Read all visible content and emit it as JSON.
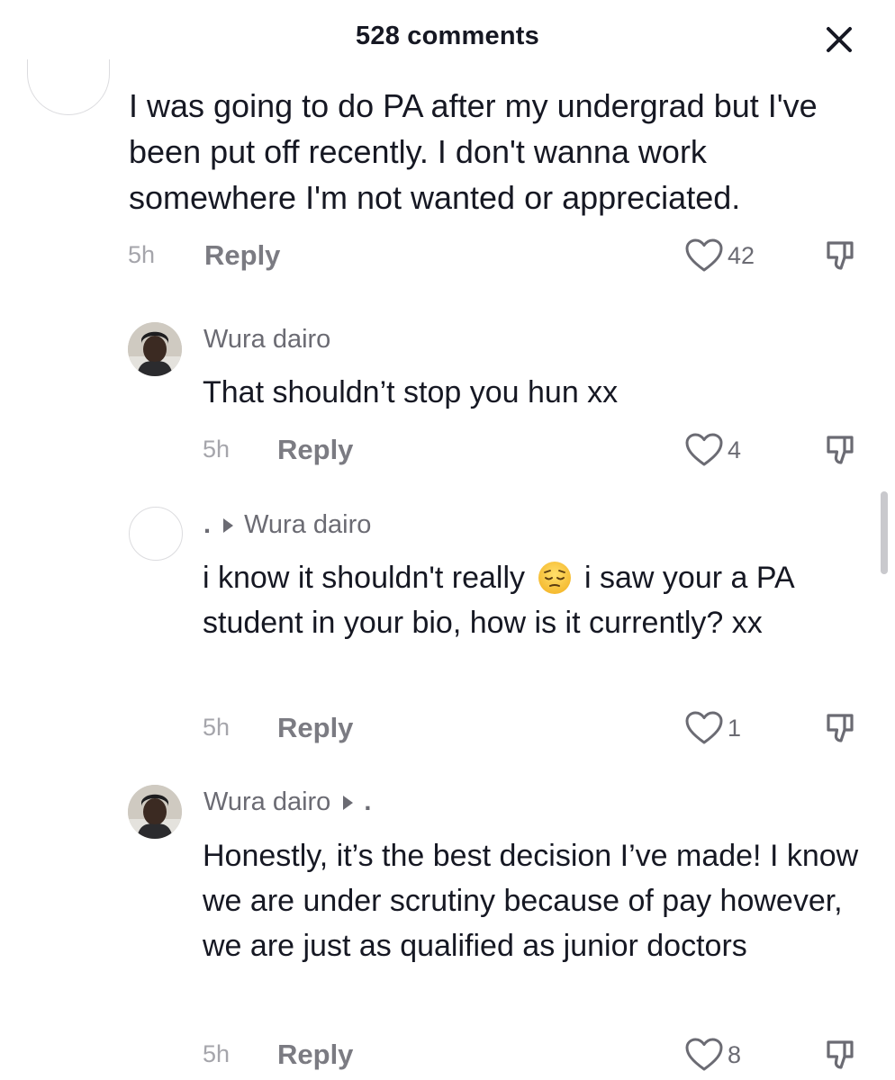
{
  "header": {
    "title": "528 comments",
    "close_icon": "close-icon"
  },
  "comments": [
    {
      "username": "",
      "text": "I was going to do PA after my undergrad but I've been put off recently. I don't wanna work somewhere I'm not wanted or appreciated.",
      "time": "5h",
      "reply_label": "Reply",
      "likes": "42"
    },
    {
      "username": "Wura dairo",
      "text": "That shouldn’t stop you hun xx",
      "time": "5h",
      "reply_label": "Reply",
      "likes": "4"
    },
    {
      "username": ".",
      "reply_to": "Wura dairo",
      "text_before": "i know it shouldn't really",
      "emoji": "pensive-face",
      "text_after": "i saw your a PA student in your bio, how is it currently? xx",
      "time": "5h",
      "reply_label": "Reply",
      "likes": "1"
    },
    {
      "username": "Wura dairo",
      "reply_to": ".",
      "text": "Honestly, it’s the best decision I’ve made! I know we are under scrutiny because of pay however, we are just as qualified as junior doctors",
      "time": "5h",
      "reply_label": "Reply",
      "likes": "8"
    }
  ],
  "colors": {
    "text": "#161823",
    "secondary": "#6b6b73",
    "muted": "#a5a5ab"
  }
}
